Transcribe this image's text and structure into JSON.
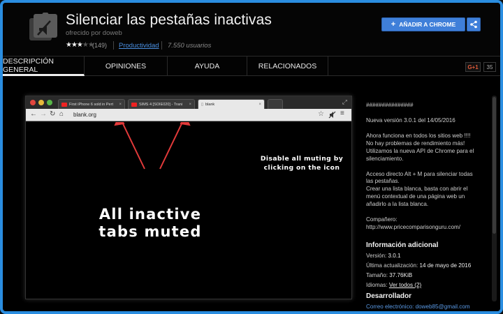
{
  "header": {
    "title": "Silenciar las pestañas inactivas",
    "offered_by": "ofrecido por doweb",
    "rating_count": "(149)",
    "category": "Productividad",
    "users": "7.550 usuarios",
    "add_button": "AÑADIR A CHROME",
    "add_icon": "plus-icon",
    "share_icon": "share-icon",
    "rating": 3.5
  },
  "tabs": [
    {
      "label": "DESCRIPCIÓN GENERAL"
    },
    {
      "label": "OPINIONES"
    },
    {
      "label": "AYUDA"
    },
    {
      "label": "RELACIONADOS"
    }
  ],
  "gplus": {
    "label": "G+1",
    "count": "35"
  },
  "screenshot": {
    "tabs": [
      "First iPhone 6 sold in Pert",
      "SIMS 4 [SOIE020] - Trani",
      "blank"
    ],
    "url": "blank.org",
    "big_text": "All inactive\ntabs muted",
    "small_text": "Disable all muting by\nclicking on the icon"
  },
  "description": [
    "###############",
    "Nueva versión 3.0.1 del 14/05/2016",
    "Ahora funciona en todos los sitios web !!!!\nNo hay problemas de rendimiento más!\nUtilizamos la nueva API de Chrome para el\nsilenciamiento.",
    "Acceso directo Alt + M para silenciar todas\nlas pestañas.\nCrear una lista blanca, basta con abrir el\nmenú contextual de una página web un\nañadirlo a la lista blanca.",
    "Compañero:\nhttp://www.pricecomparisonguru.com/"
  ],
  "info": {
    "heading": "Información adicional",
    "version_label": "Versión:",
    "version": "3.0.1",
    "updated_label": "Última actualización:",
    "updated": "14 de mayo de 2016",
    "size_label": "Tamaño:",
    "size": "37.76KiB",
    "lang_label": "Idiomas:",
    "lang": "Ver todos (2)"
  },
  "developer": {
    "heading": "Desarrollador",
    "email": "Correo electrónico: doweb85@gmail.com"
  },
  "colors": {
    "accent": "#3f7fd9",
    "frame": "#2a8de0",
    "link": "#4a8fe0"
  }
}
